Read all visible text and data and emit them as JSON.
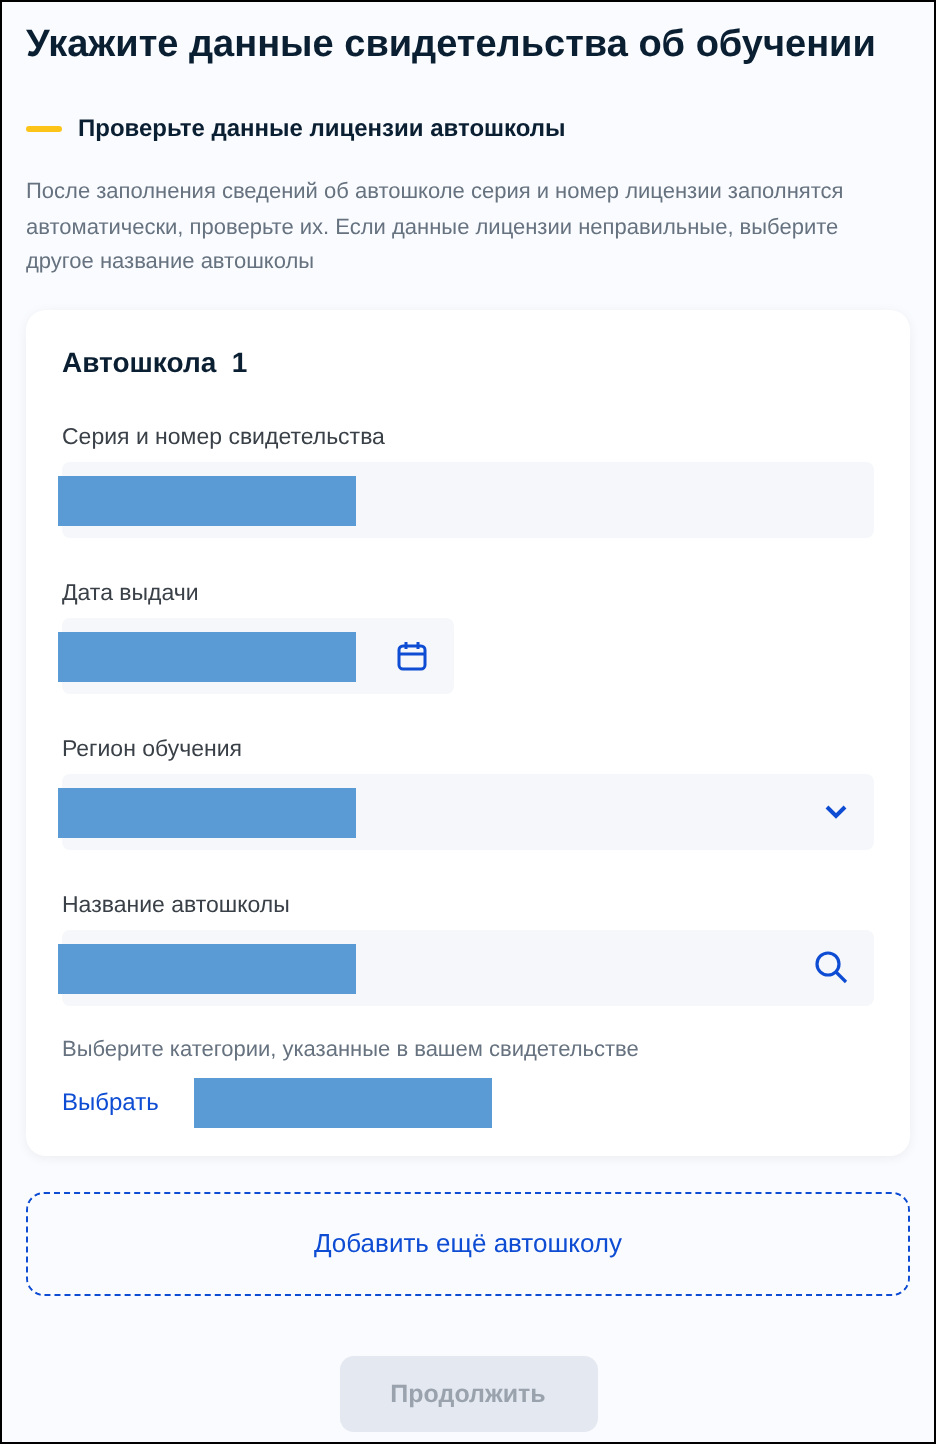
{
  "title": "Укажите данные свидетельства об обучении",
  "notice": "Проверьте данные лицензии автошколы",
  "description": "После заполнения сведений об автошколе серия и номер лицензии заполнятся автоматически, проверьте их. Если данные лицензии неправильные, выберите другое название автошколы",
  "school": {
    "heading": "Автошкола",
    "number": "1",
    "fields": [
      {
        "kind": "text",
        "label": "Серия и номер свидетельства",
        "redacted": true
      },
      {
        "kind": "date",
        "label": "Дата выдачи",
        "redacted": true
      },
      {
        "kind": "select",
        "label": "Регион обучения",
        "redacted": true
      },
      {
        "kind": "search",
        "label": "Название автошколы",
        "redacted": true
      }
    ],
    "categories": {
      "hint": "Выберите категории, указанные в вашем свидетельстве",
      "link": "Выбрать",
      "redacted": true
    }
  },
  "add_button": "Добавить ещё автошколу",
  "continue_button": {
    "label": "Продолжить",
    "disabled": true
  }
}
